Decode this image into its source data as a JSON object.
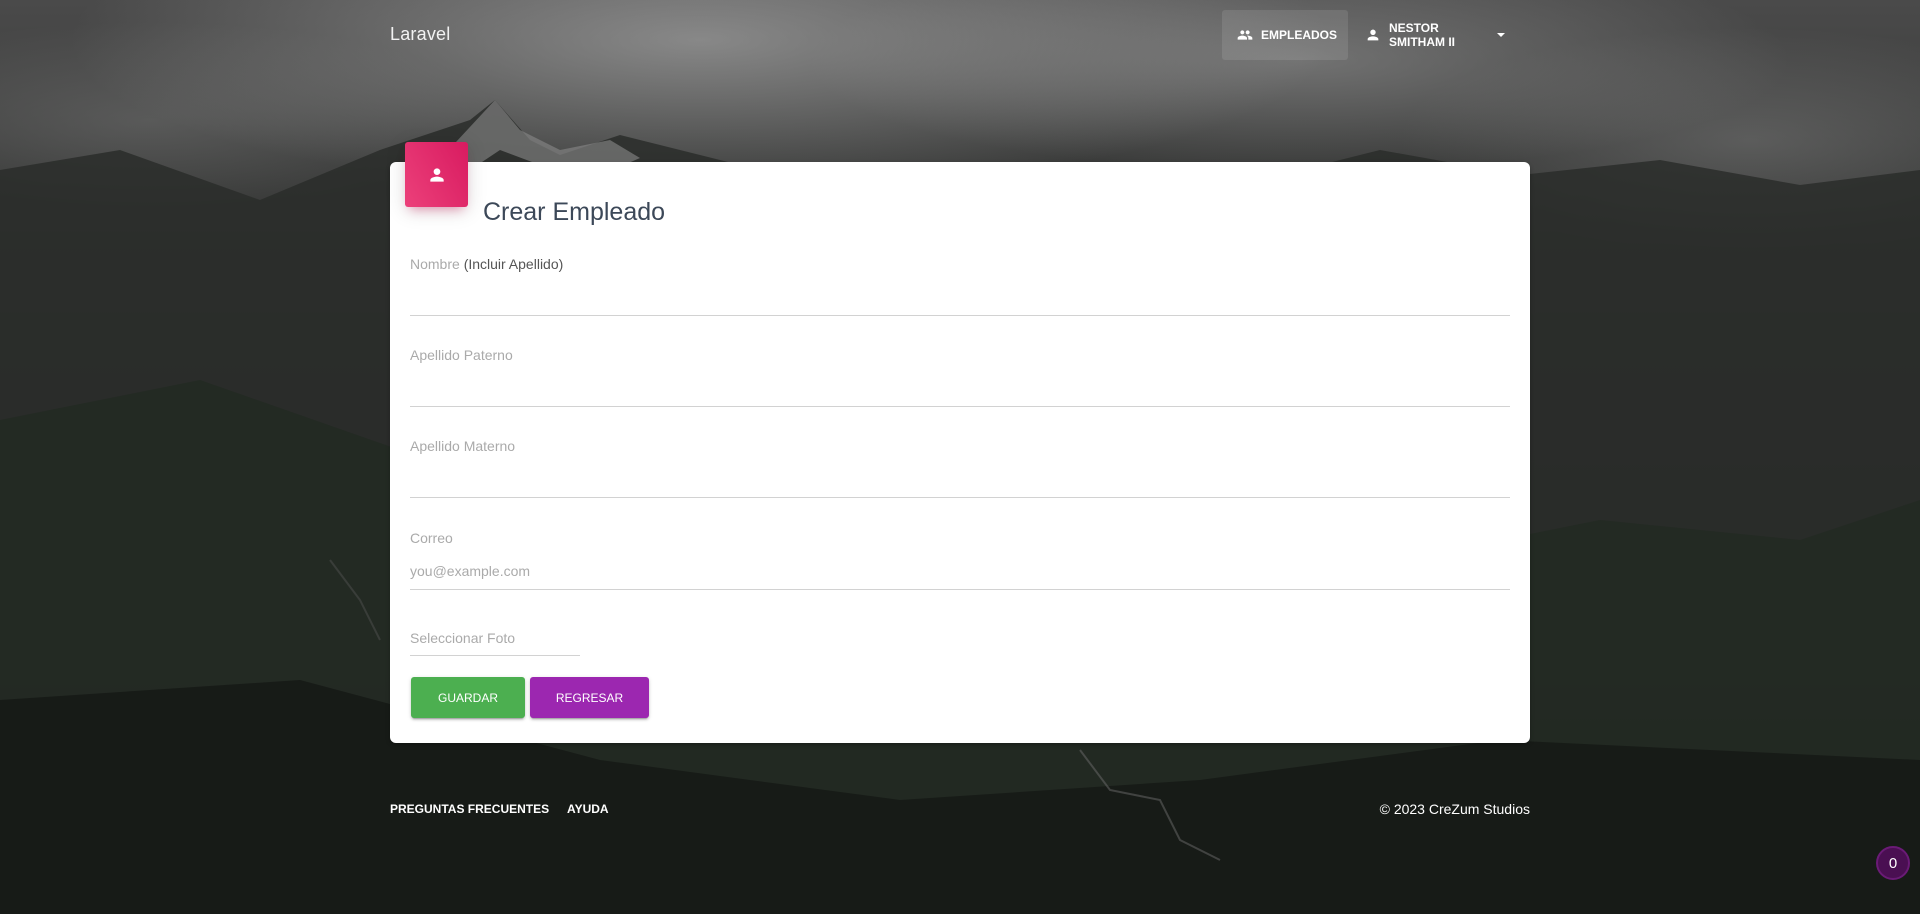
{
  "navbar": {
    "brand": "Laravel",
    "employees_label": "Empleados",
    "user_name": "Nestor Smitham II"
  },
  "card": {
    "title": "Crear Empleado",
    "fields": {
      "nombre_label": "Nombre",
      "nombre_note": "(Incluir Apellido)",
      "apellido_paterno_label": "Apellido Paterno",
      "apellido_materno_label": "Apellido Materno",
      "correo_label": "Correo",
      "correo_placeholder": "you@example.com",
      "foto_label": "Seleccionar Foto"
    },
    "buttons": {
      "save": "Guardar",
      "back": "Regresar"
    }
  },
  "footer": {
    "faq": "Preguntas Frecuentes",
    "help": "Ayuda",
    "copyright": "© 2023 CreZum Studios"
  },
  "badge_count": "0",
  "colors": {
    "card_header": "#e91e63",
    "save_button": "#4caf50",
    "back_button": "#9c27b0"
  },
  "icons": {
    "employees": "group-icon",
    "user": "person-icon",
    "card": "person-icon"
  }
}
